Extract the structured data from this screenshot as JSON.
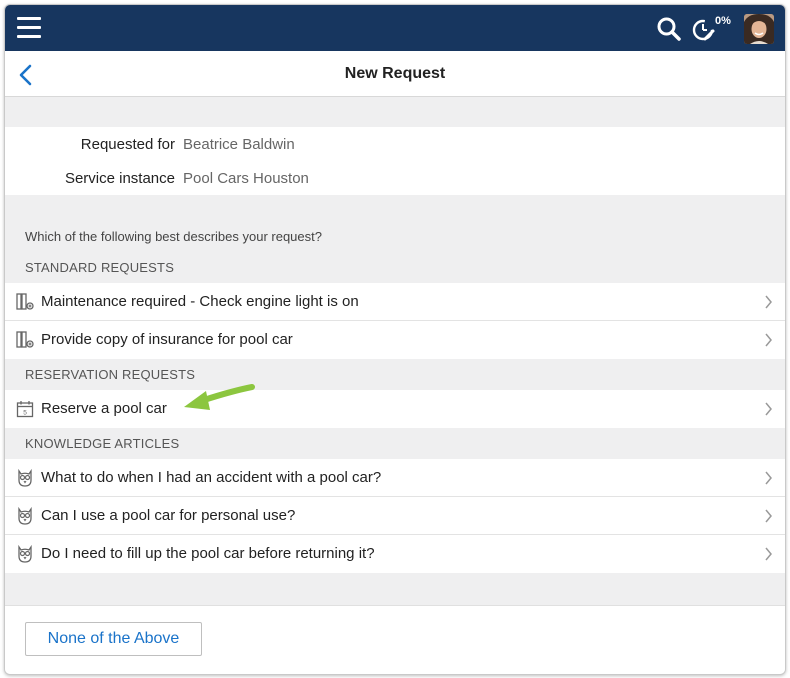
{
  "header": {
    "timer_percent": "0%",
    "icons": [
      "menu-icon",
      "search-icon",
      "timer-icon",
      "avatar"
    ],
    "bar_color": "#17365f"
  },
  "nav": {
    "title": "New Request",
    "back_icon": "chevron-left-icon"
  },
  "request_info": {
    "requested_for_label": "Requested for",
    "requested_for_value": "Beatrice Baldwin",
    "service_instance_label": "Service instance",
    "service_instance_value": "Pool Cars Houston"
  },
  "prompt": "Which of the following best describes your request?",
  "sections": {
    "standard": {
      "title": "STANDARD REQUESTS",
      "items": [
        {
          "label": "Maintenance required - Check engine light is on",
          "icon": "request-template-icon"
        },
        {
          "label": "Provide copy of insurance for pool car",
          "icon": "request-template-icon"
        }
      ]
    },
    "reservation": {
      "title": "RESERVATION REQUESTS",
      "items": [
        {
          "label": "Reserve a pool car",
          "icon": "calendar-icon"
        }
      ]
    },
    "knowledge": {
      "title": "KNOWLEDGE ARTICLES",
      "items": [
        {
          "label": "What to do when I had an accident with a pool car?",
          "icon": "owl-icon"
        },
        {
          "label": "Can I use a pool car for personal use?",
          "icon": "owl-icon"
        },
        {
          "label": "Do I need to fill up the pool car before returning it?",
          "icon": "owl-icon"
        }
      ]
    }
  },
  "footer": {
    "none_button_label": "None of the Above"
  },
  "colors": {
    "accent": "#1a73c9",
    "highlight_arrow": "#8cc63f"
  }
}
